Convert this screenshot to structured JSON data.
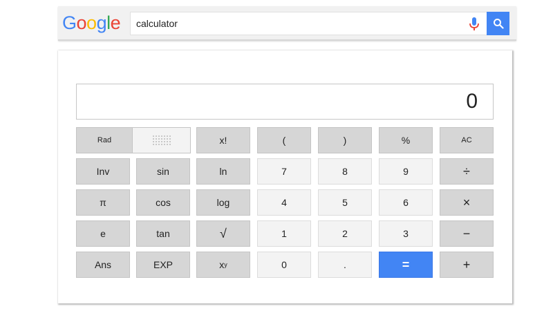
{
  "logo": {
    "letters": [
      {
        "char": "G",
        "color": "#4285F4"
      },
      {
        "char": "o",
        "color": "#EA4335"
      },
      {
        "char": "o",
        "color": "#FBBC05"
      },
      {
        "char": "g",
        "color": "#4285F4"
      },
      {
        "char": "l",
        "color": "#34A853"
      },
      {
        "char": "e",
        "color": "#EA4335"
      }
    ]
  },
  "search": {
    "query": "calculator",
    "mic_icon": "microphone-icon",
    "search_icon": "magnifier-icon",
    "accent": "#4285F4"
  },
  "calculator": {
    "display": "0",
    "mode_toggle": {
      "rad_label": "Rad",
      "deg_icon": "dot-grid-icon"
    },
    "keys": {
      "factorial": "x!",
      "lparen": "(",
      "rparen": ")",
      "percent": "%",
      "ac": "AC",
      "inv": "Inv",
      "sin": "sin",
      "ln": "ln",
      "n7": "7",
      "n8": "8",
      "n9": "9",
      "divide": "÷",
      "pi": "π",
      "cos": "cos",
      "log": "log",
      "n4": "4",
      "n5": "5",
      "n6": "6",
      "multiply": "×",
      "e": "e",
      "tan": "tan",
      "sqrt": "√",
      "n1": "1",
      "n2": "2",
      "n3": "3",
      "minus": "−",
      "ans": "Ans",
      "exp": "EXP",
      "power_base": "x",
      "power_exp": "y",
      "n0": "0",
      "dot": ".",
      "equals": "=",
      "plus": "+"
    },
    "colors": {
      "function_key": "#D6D6D6",
      "number_key": "#F3F3F3",
      "equals_key": "#4285F4"
    }
  }
}
